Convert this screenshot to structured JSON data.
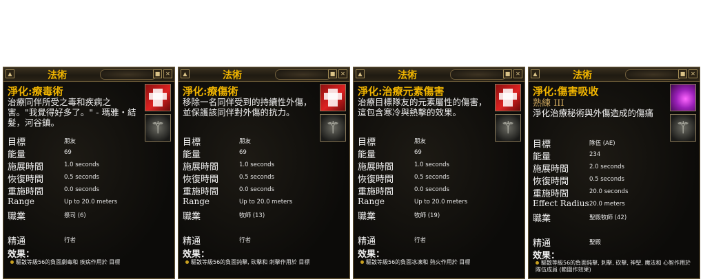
{
  "colors": {
    "title_gold": "#f0b400",
    "panel_bg": "#0d0c0a",
    "border": "#6b5a37",
    "text": "#f2f2f2"
  },
  "icons": {
    "window_arrow": "triangle-up",
    "minimize": "square",
    "close": "x",
    "skill_primary": "red-cross-heal",
    "skill_secondary": "gold-emblem"
  },
  "panels": [
    {
      "window_title": "法術",
      "spell_name": "淨化:療毒術",
      "rank": "",
      "description": "治療同伴所受之毒和疾病之害。\"我覺得好多了。\" - 瑪雅・結髮，河谷鎮。",
      "stats": [
        {
          "label": "目標",
          "value": "朋友"
        },
        {
          "label": "能量",
          "value": "69"
        },
        {
          "label": "施展時間",
          "value": "1.0 seconds"
        },
        {
          "label": "恢復時間",
          "value": "0.5 seconds"
        },
        {
          "label": "重施時間",
          "value": "0.0 seconds"
        },
        {
          "label": "Range",
          "value": "Up to 20.0 meters"
        },
        {
          "label": "職業",
          "value": "祭司 (6)"
        },
        {
          "label": "",
          "value": ""
        },
        {
          "label": "精通",
          "value": "行者"
        }
      ],
      "effects_title": "效果：",
      "effect_text": "驅散等級56的負面劇毒和 疾病作用於 目標"
    },
    {
      "window_title": "法術",
      "spell_name": "淨化:療傷術",
      "rank": "",
      "description": "移除一名同伴受到的持續性外傷，並保護該同伴對外傷的抗力。",
      "stats": [
        {
          "label": "目標",
          "value": "朋友"
        },
        {
          "label": "能量",
          "value": "69"
        },
        {
          "label": "施展時間",
          "value": "1.0 seconds"
        },
        {
          "label": "恢復時間",
          "value": "0.5 seconds"
        },
        {
          "label": "重施時間",
          "value": "0.0 seconds"
        },
        {
          "label": "Range",
          "value": "Up to 20.0 meters"
        },
        {
          "label": "職業",
          "value": "牧師 (13)"
        },
        {
          "label": "",
          "value": ""
        },
        {
          "label": "精通",
          "value": "行者"
        }
      ],
      "effects_title": "效果：",
      "effect_text": "驅散等級56的負面鈍擊, 砍擊和 刺擊作用於 目標"
    },
    {
      "window_title": "法術",
      "spell_name": "淨化:治療元素傷害",
      "rank": "",
      "description": "治療目標隊友的元素屬性的傷害，這包含寒冷與熱擊的效果。",
      "stats": [
        {
          "label": "目標",
          "value": "朋友"
        },
        {
          "label": "能量",
          "value": "69"
        },
        {
          "label": "施展時間",
          "value": "1.0 seconds"
        },
        {
          "label": "恢復時間",
          "value": "0.5 seconds"
        },
        {
          "label": "重施時間",
          "value": "0.0 seconds"
        },
        {
          "label": "Range",
          "value": "Up to 20.0 meters"
        },
        {
          "label": "職業",
          "value": "牧師 (19)"
        },
        {
          "label": "",
          "value": ""
        },
        {
          "label": "精通",
          "value": "行者"
        }
      ],
      "effects_title": "效果：",
      "effect_text": "驅散等級56的負面冰凍和 熱火作用於 目標"
    },
    {
      "window_title": "法術",
      "spell_name": "淨化:傷害吸收",
      "rank": "熟練 III",
      "description": "淨化治療秘術與外傷造成的傷痛",
      "stats": [
        {
          "label": "目標",
          "value": "隊伍 (AE)"
        },
        {
          "label": "能量",
          "value": "234"
        },
        {
          "label": "施展時間",
          "value": "2.0 seconds"
        },
        {
          "label": "恢復時間",
          "value": "0.5 seconds"
        },
        {
          "label": "重施時間",
          "value": "20.0 seconds"
        },
        {
          "label": "Effect Radius",
          "value": "20.0 meters"
        },
        {
          "label": "職業",
          "value": "聖殿牧師 (42)"
        },
        {
          "label": "",
          "value": ""
        },
        {
          "label": "精通",
          "value": "聖殿"
        }
      ],
      "effects_title": "效果：",
      "effect_text": "驅散等級56的負面鈍擊, 刺擊, 砍擊, 神聖, 魔法和 心智作用於 隊伍成員 (範圍作效果)"
    }
  ]
}
